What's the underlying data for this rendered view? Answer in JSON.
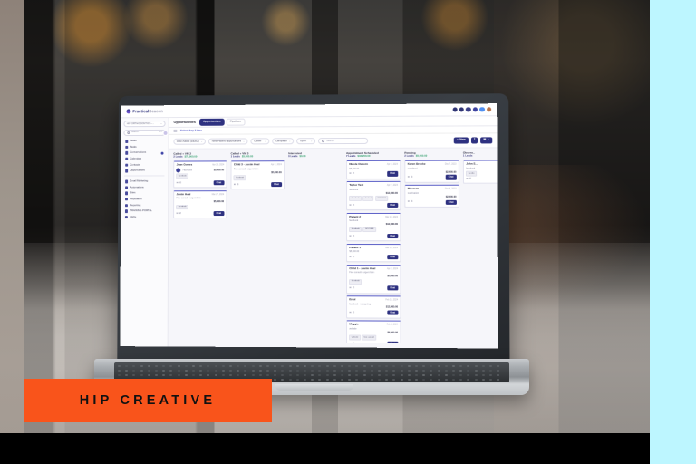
{
  "brand": {
    "part1": "Practical",
    "part2": "Beacon",
    "logo_icon": "beacon-logo-icon"
  },
  "topbar": {
    "icons": [
      "help-circle-icon",
      "clock-icon",
      "lightning-icon",
      "refresh-icon",
      "apps-icon",
      "user-avatar-icon"
    ]
  },
  "sidebar": {
    "account_selector": {
      "value": "HIP ORTHODONTICS -...",
      "caret": "chevron-down-icon"
    },
    "search": {
      "placeholder": "Search",
      "shortcut": "⌘K",
      "icon": "search-icon",
      "avatar": "avatar"
    },
    "items": [
      {
        "label": "Tasks",
        "icon": "list-icon"
      },
      {
        "label": "Tasks",
        "icon": "check-square-icon"
      },
      {
        "label": "Conversations",
        "icon": "chat-icon",
        "badge": true
      },
      {
        "label": "Calendars",
        "icon": "calendar-icon"
      },
      {
        "label": "Contacts",
        "icon": "contacts-icon"
      },
      {
        "label": "Opportunities",
        "icon": "funnel-icon"
      }
    ],
    "items2": [
      {
        "label": "Email Marketing",
        "icon": "mail-icon"
      },
      {
        "label": "Automations",
        "icon": "gear-icon"
      },
      {
        "label": "Sites",
        "icon": "globe-icon"
      },
      {
        "label": "Reputation",
        "icon": "star-icon"
      },
      {
        "label": "Reporting",
        "icon": "bar-chart-icon"
      },
      {
        "label": "TRAINING PORTAL",
        "icon": "book-icon"
      },
      {
        "label": "FAQs",
        "icon": "question-icon"
      }
    ]
  },
  "page": {
    "title": "Opportunities",
    "tabs": [
      {
        "label": "Opportunities",
        "active": true
      },
      {
        "label": "Pipelines",
        "active": false
      }
    ],
    "sublink": "Select Any 2 Ons"
  },
  "filters": {
    "sort": {
      "label": "Date Added (DESC)",
      "caret": "chevron-down-icon"
    },
    "pipeline": {
      "label": "New Patient Opportunities",
      "caret": "chevron-down-icon"
    },
    "owner": {
      "label": "Owner",
      "caret": "chevron-down-icon"
    },
    "campaign": {
      "label": "Campaign",
      "caret": "chevron-down-icon"
    },
    "status": {
      "label": "Open",
      "caret": "chevron-down-icon"
    },
    "search_placeholder": "Search",
    "new_button": "New",
    "import_icon": "import-icon",
    "export_icon": "export-icon",
    "export_caret": "chevron-down-icon"
  },
  "board": {
    "columns": [
      {
        "title": "Called + VM 2",
        "leads": "2 Leads",
        "amount": "$75,000.00",
        "cards": [
          {
            "name": "Joan Gomez",
            "date": "Apr 26, 2024",
            "source": "Facebook",
            "amount": "$5,000.00",
            "tags": [
              "facebook"
            ],
            "avatar": true,
            "button": "Chat"
          },
          {
            "name": "Justin Heal",
            "date": "Mar 27, 2024",
            "sub": "Free consult - urgent form",
            "amount": "$5,000.00",
            "tags": [
              "facebook"
            ],
            "button": "Chat"
          }
        ]
      },
      {
        "title": "Called + VM 3",
        "leads": "1 Leads",
        "amount": "$5,000.00",
        "cards": [
          {
            "name": "Child 3 - Justin Heal",
            "date": "Apr 2, 2024",
            "sub": "Free consult - urgent form",
            "amount": "$5,000.00",
            "tags": [
              "facebook"
            ],
            "button": "Chat"
          }
        ]
      },
      {
        "title": "Interested",
        "leads": "0 Leads",
        "amount": "$0.00",
        "cards": []
      },
      {
        "title": "Appointment Scheduled",
        "leads": "7 Leads",
        "amount": "$34,200.00",
        "cards": [
          {
            "name": "Nicole Osborn",
            "date": "Apr 3, 2024",
            "sub": "$5,000.00",
            "button": "Chat"
          },
          {
            "name": "Taylor Test",
            "date": "Apr 7, 2024",
            "sub": "facebook",
            "amount": "$12,400.00",
            "tags": [
              "facebook",
              "lead ad",
              "GOOGLE"
            ],
            "button": "Chat"
          },
          {
            "name": "Patient 2",
            "date": "Mar 19, 2024",
            "sub": "facebook",
            "amount": "$12,400.00",
            "tags": [
              "facebook",
              "GOOGLE"
            ],
            "button": "Chat"
          },
          {
            "name": "Patient 1",
            "date": "Mar 19, 2024",
            "sub": "$5,000.00",
            "button": "Chat"
          },
          {
            "name": "Child 1 - Justin Heal",
            "date": "Apr 2, 2024",
            "sub": "Free consult - urgent form",
            "amount": "$5,000.00",
            "tags": [
              "facebook"
            ],
            "button": "Chat"
          },
          {
            "name": "Errol",
            "date": "Feb 21, 2024",
            "sub": "facebook - retargeting",
            "amount": "$12,400.00",
            "button": "Chat"
          },
          {
            "name": "Maggie",
            "date": "Feb 6, 2024",
            "sub": "website",
            "amount": "$6,000.00",
            "tags": [
              "website",
              "free consult"
            ],
            "button": "Chat"
          }
        ]
      },
      {
        "title": "Pending",
        "leads": "2 Leads",
        "amount": "$5,000.00",
        "cards": [
          {
            "name": "Karen Brooke",
            "date": "Dec 7, 2023",
            "sub": "undefined",
            "amount": "$2,500.00",
            "button": "Chat"
          },
          {
            "name": "Maureen",
            "date": "Dec 4, 2023",
            "sub": "reactivation",
            "amount": "$2,500.00",
            "button": "Chat"
          }
        ]
      },
      {
        "title": "Observ...",
        "leads": "1 Leads",
        "amount": "",
        "cards": [
          {
            "name": "John S...",
            "date": "",
            "sub": "facebook",
            "tags": [
              "facebo"
            ],
            "button": ""
          }
        ]
      }
    ]
  },
  "overlay": {
    "banner_text": "HIP CREATIVE",
    "banner_color": "#f9541b",
    "accent_cyan": "#bdf6ff"
  }
}
